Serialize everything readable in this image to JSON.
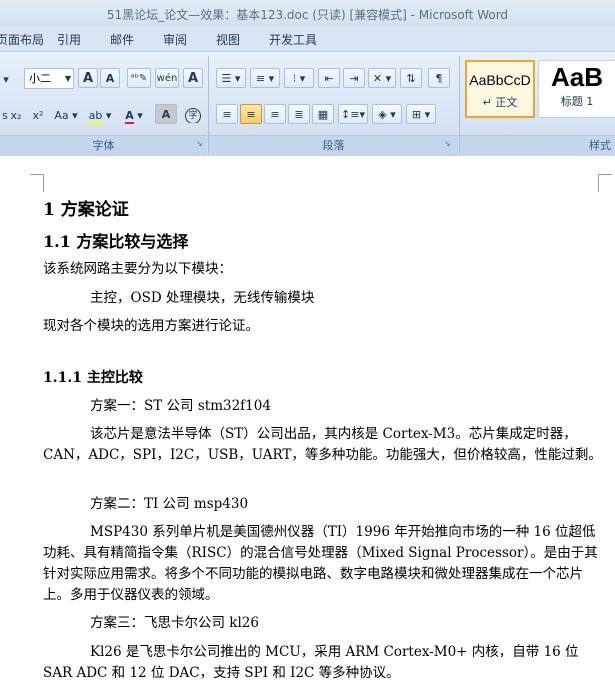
{
  "window": {
    "title": "51黑论坛_论文—效果：基本123.doc (只读) [兼容模式] - Microsoft Word"
  },
  "ribbon_tabs": [
    "页面布局",
    "引用",
    "邮件",
    "审阅",
    "视图",
    "开发工具"
  ],
  "font_group": {
    "label": "字体",
    "font_size": "小二",
    "grow_font": "A",
    "shrink_font": "A",
    "change_case": "Aa",
    "clear_format": "A",
    "wen_button": "wén",
    "border_char": "A",
    "strike": "abe",
    "subscript": "x₂",
    "superscript": "x²",
    "highlight": "ab",
    "font_color": "A",
    "shade_char": "A",
    "enclose_char": "字"
  },
  "paragraph_group": {
    "label": "段落"
  },
  "styles_group": {
    "label": "样式",
    "styles": [
      {
        "preview": "AaBbCcD",
        "name": "↵ 正文"
      },
      {
        "preview": "AaB",
        "name": "标题 1"
      }
    ]
  },
  "document": {
    "h1": "1  方案论证",
    "h2": "1.1 方案比较与选择",
    "p1": "该系统网路主要分为以下模块：",
    "p2": "主控，OSD 处理模块，无线传输模块",
    "p3": "现对各个模块的选用方案进行论证。",
    "h3": "1.1.1 主控比较",
    "opt1": "方案一：ST 公司 stm32f104",
    "opt1_desc": "该芯片是意法半导体（ST）公司出品，其内核是 Cortex-M3。芯片集成定时器，CAN，ADC，SPI，I2C，USB，UART，等多种功能。功能强大，但价格较高，性能过剩。",
    "opt2": "方案二：TI 公司 msp430",
    "opt2_desc": "MSP430 系列单片机是美国德州仪器（TI）1996 年开始推向市场的一种 16 位超低功耗、具有精简指令集（RISC）的混合信号处理器（Mixed Signal Processor）。是由于其针对实际应用需求。将多个不同功能的模拟电路、数字电路模块和微处理器集成在一个芯片上。多用于仪器仪表的领域。",
    "opt3": "方案三：飞思卡尔公司 kl26",
    "opt3_desc": "Kl26 是飞思卡尔公司推出的 MCU，采用 ARM Cortex-M0+ 内核，自带 16 位 SAR ADC 和 12 位 DAC，支持 SPI 和 I2C 等多种协议。"
  }
}
